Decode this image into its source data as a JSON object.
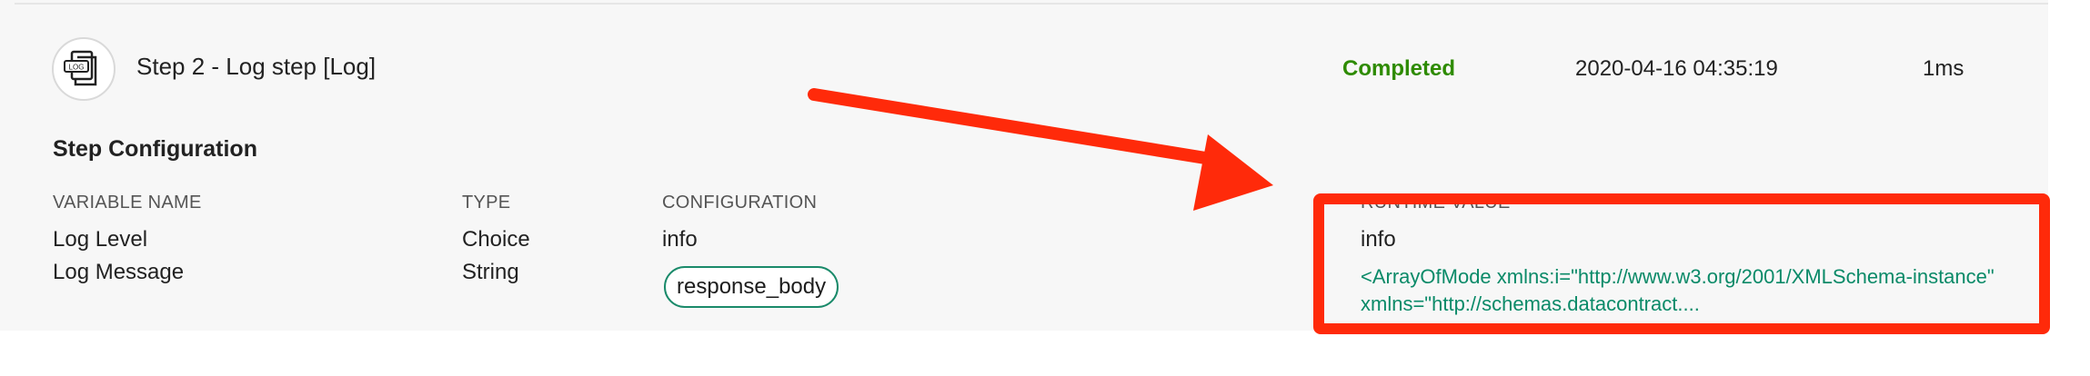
{
  "step": {
    "title": "Step 2 - Log step [Log]",
    "icon_label": "LOG",
    "status": "Completed",
    "timestamp": "2020-04-16 04:35:19",
    "duration": "1ms"
  },
  "section": {
    "title": "Step Configuration"
  },
  "columns": {
    "variable_name": "VARIABLE NAME",
    "type": "TYPE",
    "configuration": "CONFIGURATION",
    "runtime_value": "RUNTIME VALUE"
  },
  "rows": [
    {
      "name": "Log Level",
      "type": "Choice",
      "configuration": "info",
      "runtime_value": "info"
    },
    {
      "name": "Log Message",
      "type": "String",
      "configuration": "response_body",
      "runtime_value": "<ArrayOfMode xmlns:i=\"http://www.w3.org/2001/XMLSchema-instance\" xmlns=\"http://schemas.datacontract...."
    }
  ],
  "colors": {
    "status_completed": "#2e8b00",
    "highlight": "#ff2a0a",
    "link": "#0a8a68",
    "pill_border": "#1a8a6a"
  },
  "icons": {
    "step_icon": "log-document-icon"
  }
}
